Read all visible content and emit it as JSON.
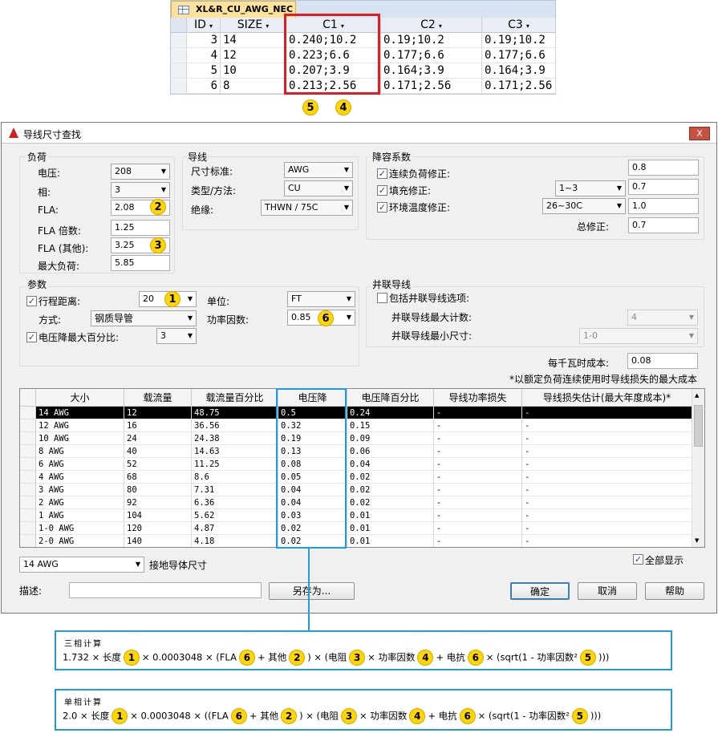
{
  "top_table": {
    "tab_title": "XL&R_CU_AWG_NEC",
    "headers": [
      "ID",
      "SIZE",
      "C1",
      "C2",
      "C3"
    ],
    "rows": [
      [
        "3",
        "14",
        "0.240;10.2",
        "0.19;10.2",
        "0.19;10.2"
      ],
      [
        "4",
        "12",
        "0.223;6.6",
        "0.177;6.6",
        "0.177;6.6"
      ],
      [
        "5",
        "10",
        "0.207;3.9",
        "0.164;3.9",
        "0.164;3.9"
      ],
      [
        "6",
        "8",
        "0.213;2.56",
        "0.171;2.56",
        "0.171;2.56"
      ]
    ],
    "callouts": [
      "5",
      "4"
    ]
  },
  "dialog": {
    "title": "导线尺寸查找",
    "close_label": "X",
    "load": {
      "title": "负荷",
      "voltage_label": "电压:",
      "voltage": "208",
      "phase_label": "相:",
      "phase": "3",
      "fla_label": "FLA:",
      "fla": "2.08",
      "fla_callout": "2",
      "fla_mult_label": "FLA 倍数:",
      "fla_mult": "1.25",
      "fla_other_label": "FLA (其他):",
      "fla_other": "3.25",
      "fla_other_callout": "3",
      "max_load_label": "最大负荷:",
      "max_load": "5.85"
    },
    "conductor": {
      "title": "导线",
      "size_std_label": "尺寸标准:",
      "size_std": "AWG",
      "type_label": "类型/方法:",
      "type": "CU",
      "insulation_label": "绝缘:",
      "insulation": "THWN / 75C"
    },
    "derating": {
      "title": "降容系数",
      "continuous_label": "连续负荷修正:",
      "continuous": "0.8",
      "fill_label": "填充修正:",
      "fill_combo": "1~3",
      "fill": "0.7",
      "ambient_label": "环境温度修正:",
      "ambient_combo": "26~30C",
      "ambient": "1.0",
      "total_label": "总修正:",
      "total": "0.7"
    },
    "params": {
      "title": "参数",
      "run_label": "行程距离:",
      "run": "20",
      "run_callout": "1",
      "unit_label": "单位:",
      "unit": "FT",
      "method_label": "方式:",
      "method": "钢质导管",
      "pf_label": "功率因数:",
      "pf": "0.85",
      "pf_callout": "6",
      "vdrop_label": "电压降最大百分比:",
      "vdrop": "3"
    },
    "parallel": {
      "title": "并联导线",
      "include_label": "包括并联导线选项:",
      "max_count_label": "并联导线最大计数:",
      "max_count": "4",
      "min_size_label": "并联导线最小尺寸:",
      "min_size": "1-0"
    },
    "cost_label": "每千瓦时成本:",
    "cost": "0.08",
    "cost_note": "*以额定负荷连续使用时导线损失的最大成本",
    "grid": {
      "headers": [
        "大小",
        "载流量",
        "载流量百分比",
        "电压降",
        "电压降百分比",
        "导线功率损失",
        "导线损失估计(最大年度成本)*"
      ],
      "rows": [
        [
          "14 AWG",
          "12",
          "48.75",
          "0.5",
          "0.24",
          "-",
          "-"
        ],
        [
          "12 AWG",
          "16",
          "36.56",
          "0.32",
          "0.15",
          "-",
          "-"
        ],
        [
          "10 AWG",
          "24",
          "24.38",
          "0.19",
          "0.09",
          "-",
          "-"
        ],
        [
          "8 AWG",
          "40",
          "14.63",
          "0.13",
          "0.06",
          "-",
          "-"
        ],
        [
          "6 AWG",
          "52",
          "11.25",
          "0.08",
          "0.04",
          "-",
          "-"
        ],
        [
          "4 AWG",
          "68",
          "8.6",
          "0.05",
          "0.02",
          "-",
          "-"
        ],
        [
          "3 AWG",
          "80",
          "7.31",
          "0.04",
          "0.02",
          "-",
          "-"
        ],
        [
          "2 AWG",
          "92",
          "6.36",
          "0.04",
          "0.02",
          "-",
          "-"
        ],
        [
          "1 AWG",
          "104",
          "5.62",
          "0.03",
          "0.01",
          "-",
          "-"
        ],
        [
          "1-0 AWG",
          "120",
          "4.87",
          "0.02",
          "0.01",
          "-",
          "-"
        ],
        [
          "2-0 AWG",
          "140",
          "4.18",
          "0.02",
          "0.01",
          "-",
          "-"
        ]
      ]
    },
    "ground_size": "14 AWG",
    "ground_label": "接地导体尺寸",
    "show_all_label": "全部显示",
    "desc_label": "描述:",
    "save_as_label": "另存为...",
    "ok_label": "确定",
    "cancel_label": "取消",
    "help_label": "帮助"
  },
  "formula_three": {
    "title": "三相计算",
    "t1": "1.732 × 长度",
    "c1": "1",
    "t2": "× 0.0003048 × (FLA",
    "c2": "6",
    "t3": "+ 其他",
    "c3": "2",
    "t4": ") × (电阻",
    "c4": "3",
    "t5": "× 功率因数",
    "c5": "4",
    "t6": "+ 电抗",
    "c6": "6",
    "t7": "× (sqrt(1 - 功率因数²",
    "c7": "5",
    "t8": ")))"
  },
  "formula_single": {
    "title": "单相计算",
    "t1": "2.0 × 长度",
    "c1": "1",
    "t2": "× 0.0003048 × ((FLA",
    "c2": "6",
    "t3": "+ 其他",
    "c3": "2",
    "t4": ") × (电阻",
    "c4": "3",
    "t5": "× 功率因数",
    "c5": "4",
    "t6": "+ 电抗",
    "c6": "6",
    "t7": "× (sqrt(1 - 功率因数²",
    "c7": "5",
    "t8": ")))"
  },
  "colors": {
    "highlight_red": "#e31b23",
    "highlight_blue": "#1f9be2",
    "callout_yellow": "#ffd600"
  }
}
